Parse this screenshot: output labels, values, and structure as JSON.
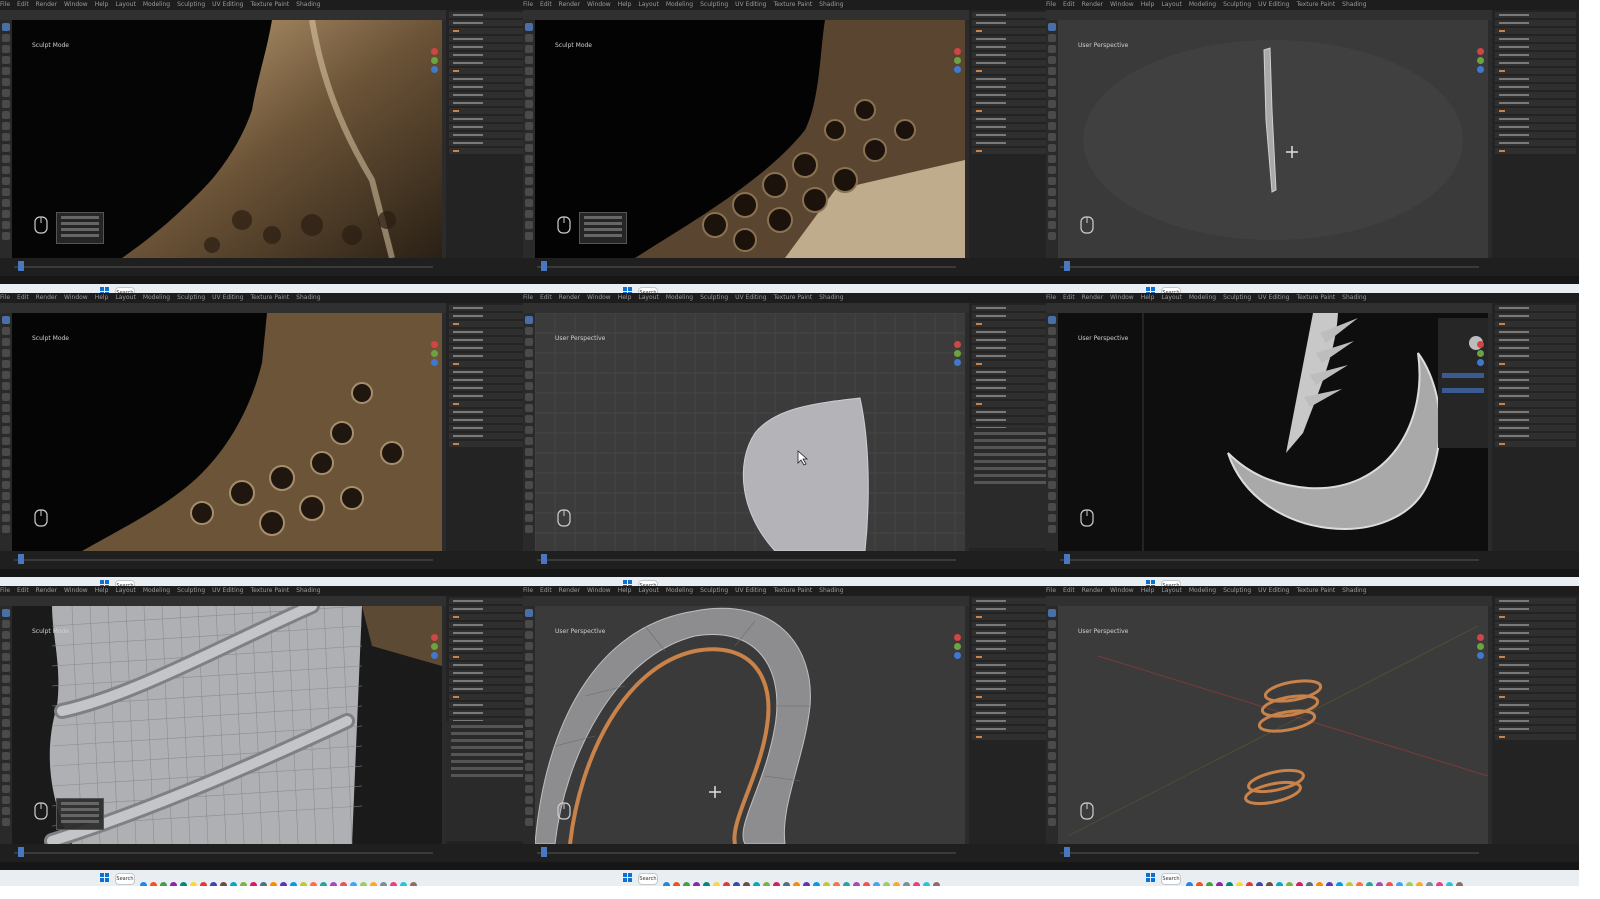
{
  "panels": [
    {
      "id": 1,
      "scene": "sculpt-dark-gold",
      "object_label": "Sculpt Mode",
      "has_op_panel": true
    },
    {
      "id": 2,
      "scene": "sculpt-dark-gold-spheres",
      "object_label": "Sculpt Mode",
      "has_op_panel": true
    },
    {
      "id": 3,
      "scene": "thin-vertical-mesh",
      "object_label": "User Perspective",
      "has_op_panel": false
    },
    {
      "id": 4,
      "scene": "sculpt-dark-gold-2",
      "object_label": "Sculpt Mode",
      "has_op_panel": false
    },
    {
      "id": 5,
      "scene": "blob-shape",
      "object_label": "User Perspective",
      "has_op_panel": false
    },
    {
      "id": 6,
      "scene": "crescent-blade",
      "object_label": "User Perspective",
      "has_op_panel": false
    },
    {
      "id": 7,
      "scene": "tube-wires",
      "object_label": "Sculpt Mode",
      "has_op_panel": true
    },
    {
      "id": 8,
      "scene": "loop-mesh",
      "object_label": "User Perspective",
      "has_op_panel": false
    },
    {
      "id": 9,
      "scene": "orange-rings",
      "object_label": "User Perspective",
      "has_op_panel": false
    }
  ],
  "menu": [
    "File",
    "Edit",
    "Render",
    "Window",
    "Help",
    "Layout",
    "Modeling",
    "Sculpting",
    "UV Editing",
    "Texture Paint",
    "Shading"
  ],
  "taskbar": {
    "search_label": "Search"
  },
  "colors": {
    "accent": "#4a78c0",
    "orange": "#c8824a",
    "taskbar": "#e9eef3"
  }
}
